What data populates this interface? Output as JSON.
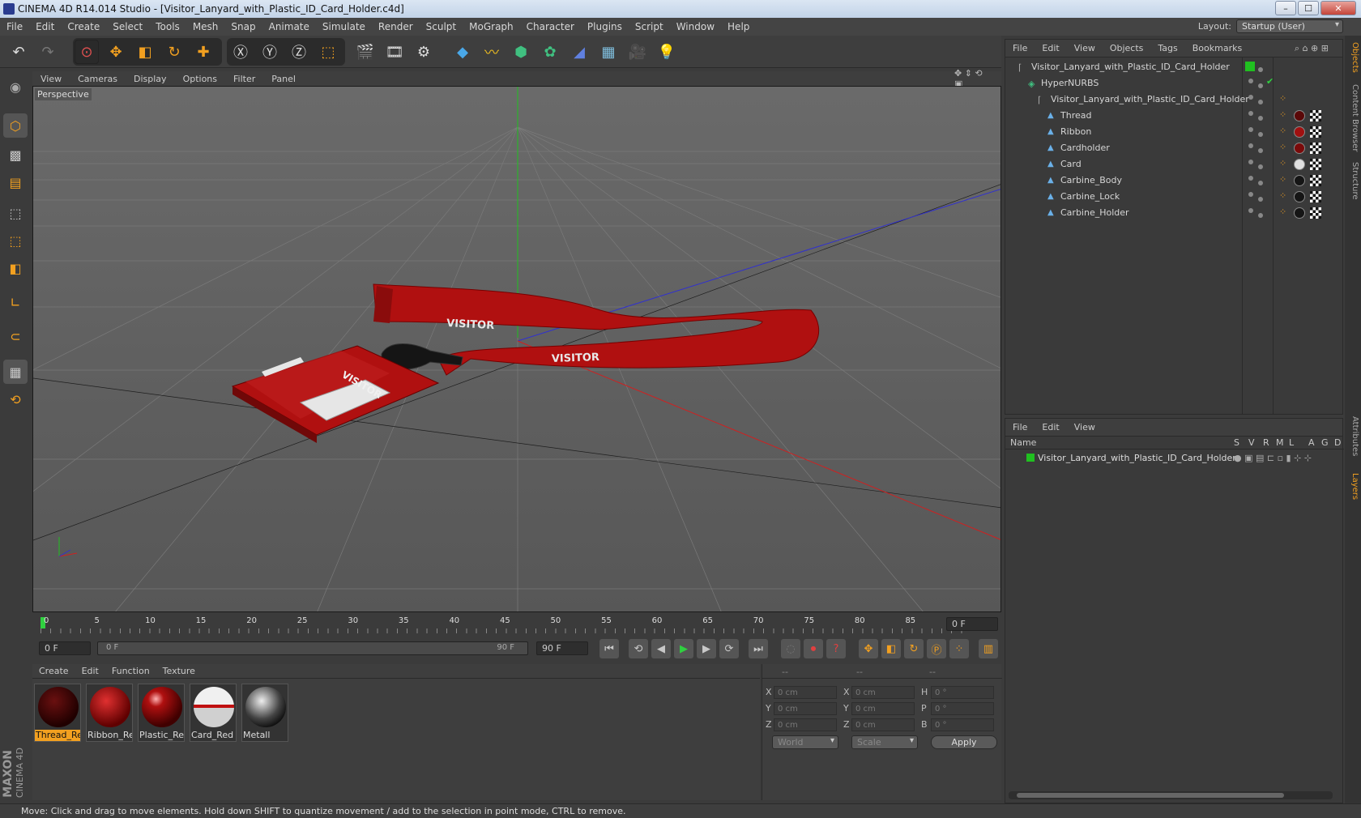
{
  "window": {
    "title": "CINEMA 4D R14.014 Studio - [Visitor_Lanyard_with_Plastic_ID_Card_Holder.c4d]",
    "min": "–",
    "max": "☐",
    "close": "✕"
  },
  "menu": [
    "File",
    "Edit",
    "Create",
    "Select",
    "Tools",
    "Mesh",
    "Snap",
    "Animate",
    "Simulate",
    "Render",
    "Sculpt",
    "MoGraph",
    "Character",
    "Plugins",
    "Script",
    "Window",
    "Help"
  ],
  "layout": {
    "label": "Layout:",
    "value": "Startup (User)"
  },
  "viewport": {
    "menu": [
      "View",
      "Cameras",
      "Display",
      "Options",
      "Filter",
      "Panel"
    ],
    "label": "Perspective",
    "lanyard_text": "VISITOR",
    "card_text": "VISITOR"
  },
  "timeline": {
    "ticks": [
      "0",
      "5",
      "10",
      "15",
      "20",
      "25",
      "30",
      "35",
      "40",
      "45",
      "50",
      "55",
      "60",
      "65",
      "70",
      "75",
      "80",
      "85",
      "90"
    ],
    "current_frame": "0 F",
    "start": "0 F",
    "range_start": "0 F",
    "range_end": "90 F",
    "end": "90 F"
  },
  "materials": {
    "menu": [
      "Create",
      "Edit",
      "Function",
      "Texture"
    ],
    "items": [
      "Thread_Red",
      "Ribbon_Re",
      "Plastic_Red",
      "Card_Red",
      "Metall"
    ]
  },
  "coords": {
    "headers": [
      "--",
      "--",
      "--"
    ],
    "rows": [
      {
        "a": "X",
        "av": "0 cm",
        "b": "X",
        "bv": "0 cm",
        "c": "H",
        "cv": "0 °"
      },
      {
        "a": "Y",
        "av": "0 cm",
        "b": "Y",
        "bv": "0 cm",
        "c": "P",
        "cv": "0 °"
      },
      {
        "a": "Z",
        "av": "0 cm",
        "b": "Z",
        "bv": "0 cm",
        "c": "B",
        "cv": "0 °"
      }
    ],
    "space": "World",
    "mode": "Scale",
    "apply": "Apply"
  },
  "objects": {
    "menu": [
      "File",
      "Edit",
      "View",
      "Objects",
      "Tags",
      "Bookmarks"
    ],
    "tree": [
      {
        "name": "Visitor_Lanyard_with_Plastic_ID_Card_Holder",
        "indent": 0
      },
      {
        "name": "HyperNURBS",
        "indent": 1
      },
      {
        "name": "Visitor_Lanyard_with_Plastic_ID_Card_Holder",
        "indent": 2
      },
      {
        "name": "Thread",
        "indent": 3
      },
      {
        "name": "Ribbon",
        "indent": 3
      },
      {
        "name": "Cardholder",
        "indent": 3
      },
      {
        "name": "Card",
        "indent": 3
      },
      {
        "name": "Carbine_Body",
        "indent": 3
      },
      {
        "name": "Carbine_Lock",
        "indent": 3
      },
      {
        "name": "Carbine_Holder",
        "indent": 3
      }
    ]
  },
  "layers": {
    "menu": [
      "File",
      "Edit",
      "View"
    ],
    "header": "Name",
    "cols": [
      "S",
      "V",
      "R",
      "M",
      "L",
      "A",
      "G",
      "D"
    ],
    "row": "Visitor_Lanyard_with_Plastic_ID_Card_Holder"
  },
  "right_tabs": [
    "Objects",
    "Content Browser",
    "Structure",
    "Attributes",
    "Layers"
  ],
  "status": "Move: Click and drag to move elements. Hold down SHIFT to quantize movement / add to the selection in point mode, CTRL to remove.",
  "brand": {
    "line1": "MAXON",
    "line2": "CINEMA 4D"
  },
  "colors": {
    "accent": "#f2a020",
    "green_axis": "#20c020",
    "red_axis": "#d02020",
    "blue_axis": "#2020d0"
  }
}
